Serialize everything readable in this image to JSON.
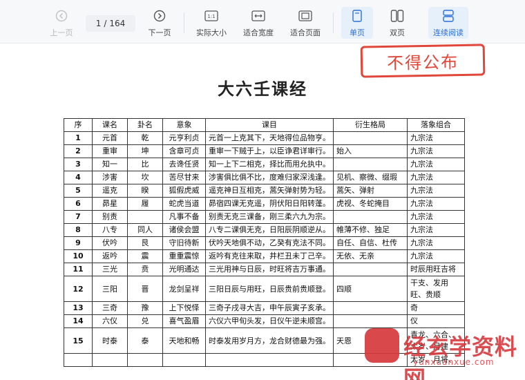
{
  "toolbar": {
    "prev_label": "上一页",
    "next_label": "下一页",
    "page_current": "1",
    "page_total": "164",
    "actual_size_label": "实际大小",
    "fit_width_label": "适合宽度",
    "fit_page_label": "适合页面",
    "single_page_label": "单页",
    "double_page_label": "双页",
    "continuous_label": "连续阅读"
  },
  "doc": {
    "stamp": "不得公布",
    "title": "大六壬课经",
    "headers": [
      "序",
      "课名",
      "卦名",
      "意象",
      "课目",
      "衍生格局",
      "落象组合"
    ],
    "rows": [
      [
        "1",
        "元首",
        "乾",
        "元亨利贞",
        "元首一上克其下，天地得位品物亨。",
        "",
        "九宗法"
      ],
      [
        "2",
        "重审",
        "坤",
        "含章可贞",
        "重审一下贼于上，以臣诤君详审行。",
        "始入",
        "九宗法"
      ],
      [
        "3",
        "知一",
        "比",
        "去谗任贤",
        "知一上下二相克，择比而用允执中。",
        "",
        "九宗法"
      ],
      [
        "4",
        "涉害",
        "坎",
        "苦尽甘来",
        "涉害俱比俱不比，度难归家深浅逢。",
        "见机、察微、缀瑕",
        "九宗法"
      ],
      [
        "5",
        "遥克",
        "睽",
        "狐假虎威",
        "遥克神日互相克，蒿矢弹射势为轻。",
        "蒿矢、弹射",
        "九宗法"
      ],
      [
        "6",
        "昴星",
        "履",
        "蛇虎当道",
        "昴宿四课无克遥，阴伏阳日阳转蓬。",
        "虎视、冬蛇掩目",
        "九宗法"
      ],
      [
        "7",
        "别责",
        "",
        "凡事不备",
        "别责无克三课备，刚三柔六九为宗。",
        "",
        "九宗法"
      ],
      [
        "8",
        "八专",
        "同人",
        "诸侯会盟",
        "八专二课俱无克，日阳辰阴顺逆从。",
        "帷薄不修、独足",
        "九宗法"
      ],
      [
        "9",
        "伏吟",
        "艮",
        "守旧待新",
        "伏吟天地俱不动，乙癸有克法不同。",
        "自任、自信、杜传",
        "九宗法"
      ],
      [
        "10",
        "返吟",
        "震",
        "重重震惊",
        "返吟有克往来取，井栏丑未丁己辛。",
        "无依、无亲",
        "九宗法"
      ],
      [
        "11",
        "三光",
        "贲",
        "光明通达",
        "三光用神与日辰，时旺将吉万事通。",
        "",
        "时辰用旺吉将"
      ],
      [
        "12",
        "三阳",
        "晋",
        "龙剑呈祥",
        "三阳日辰与用旺，日辰贵前贵顺登。",
        "四顺",
        "干支、发用旺、贵顺"
      ],
      [
        "13",
        "三奇",
        "豫",
        "上下悦怿",
        "三奇子戌寻大吉，申午辰寅子亥承。",
        "",
        "奇"
      ],
      [
        "14",
        "六仪",
        "兑",
        "喜气盈眉",
        "六仪六甲旬头发，日仪午逆未顺宫。",
        "",
        "仪"
      ],
      [
        "15",
        "时泰",
        "泰",
        "天地和畅",
        "时泰发用岁月方，龙合财德最为强。",
        "天恩",
        "青龙、六合、太岁、月建"
      ],
      [
        "",
        "",
        "",
        "",
        "",
        "",
        "太岁、月将、"
      ]
    ],
    "watermark_brand": "经玄学资料网",
    "watermark_url": "yunxuanxue.com"
  }
}
